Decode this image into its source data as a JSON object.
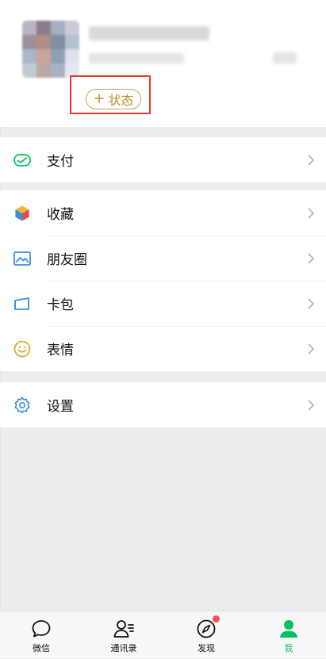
{
  "profile": {
    "status_plus": "+",
    "status_label": "状态"
  },
  "menu": {
    "pay": "支付",
    "favorites": "收藏",
    "moments": "朋友圈",
    "cards": "卡包",
    "stickers": "表情",
    "settings": "设置"
  },
  "tabs": {
    "chats": "微信",
    "contacts": "通讯录",
    "discover": "发现",
    "me": "我"
  },
  "colors": {
    "accent_green": "#07c160",
    "status_gold": "#b8902d",
    "highlight_red": "#e53935",
    "badge_red": "#fa5151"
  }
}
